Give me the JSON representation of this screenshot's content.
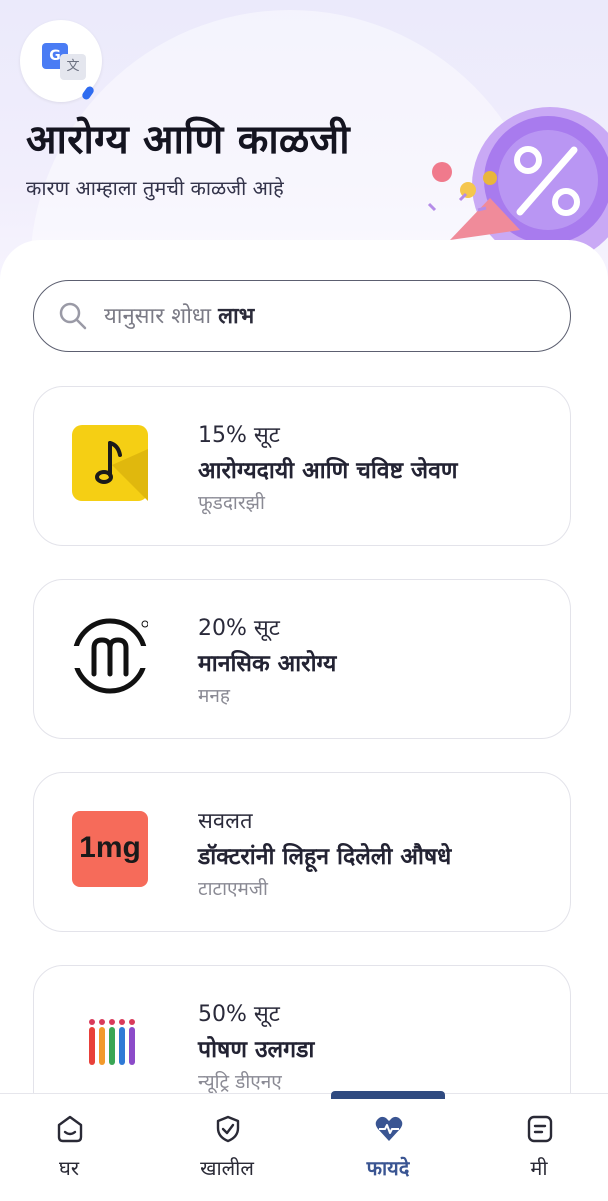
{
  "header": {
    "title": "आरोग्य आणि काळजी",
    "subtitle": "कारण आम्हाला तुमची काळजी आहे",
    "translate_icon_letter": "G",
    "translate_icon_glyph": "文"
  },
  "search": {
    "placeholder_prefix": "यानुसार शोधा ",
    "placeholder_keyword": "लाभ"
  },
  "offers": [
    {
      "kicker": "15% सूट",
      "title": "आरोग्यदायी आणि चविष्ट जेवण",
      "partner": "फूडदारझी",
      "logo_icon": "music-note-logo-icon"
    },
    {
      "kicker": "20% सूट",
      "title": "मानसिक आरोग्य",
      "partner": "मनह",
      "logo_icon": "manah-logo-icon"
    },
    {
      "kicker": "सवलत",
      "title": "डॉक्टरांनी लिहून दिलेली औषधे",
      "partner": "टाटाएमजी",
      "logo_icon": "1mg-logo-icon",
      "logo_text": "1mg"
    },
    {
      "kicker": "50% सूट",
      "title": "पोषण उलगडा",
      "partner": "न्यूट्रि डीएनए",
      "logo_icon": "nutri-dna-logo-icon"
    }
  ],
  "nav": {
    "items": [
      {
        "label": "घर",
        "icon": "home-face-icon"
      },
      {
        "label": "खालील",
        "icon": "shield-check-icon"
      },
      {
        "label": "फायदे",
        "icon": "heart-pulse-icon",
        "active": true
      },
      {
        "label": "मी",
        "icon": "document-icon"
      }
    ]
  },
  "colors": {
    "accent": "#3a5592",
    "nav_indicator": "#2f4a80",
    "hero_background": "#ebeafb",
    "foodarazzi_yellow": "#f5cf14",
    "tata1mg_red": "#f66b5a"
  }
}
